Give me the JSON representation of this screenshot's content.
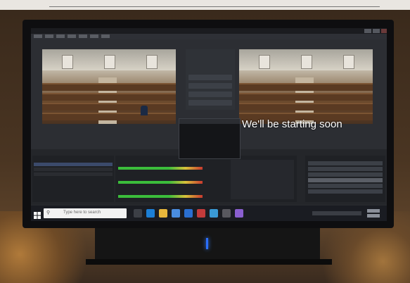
{
  "preview_overlay_text": "We'll be starting soon",
  "taskbar": {
    "search_placeholder": "Type here to search"
  },
  "colors": {
    "monitor_bezel": "#0e0e10",
    "screen_bg": "#26282c",
    "power_led": "#2b6fff",
    "overlay_text": "#ffffff"
  },
  "icons": [
    "windows-start-icon",
    "search-icon",
    "task-view-icon",
    "edge-icon",
    "file-explorer-icon",
    "store-icon",
    "mail-icon",
    "obs-icon"
  ]
}
